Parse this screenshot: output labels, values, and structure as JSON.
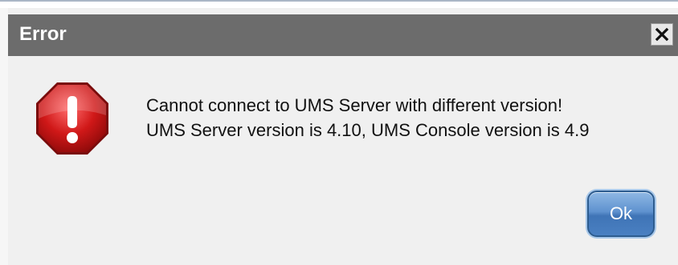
{
  "dialog": {
    "title": "Error",
    "message_line1": "Cannot connect to UMS Server with different version!",
    "message_line2": "UMS Server version is 4.10, UMS Console version is 4.9",
    "ok_label": "Ok",
    "icon": "error-stop-icon",
    "close_icon": "close-icon"
  },
  "colors": {
    "titlebar": "#6c6c6c",
    "body": "#f0f0f0",
    "icon_red": "#d01818",
    "ok_blue": "#4a80c2"
  }
}
